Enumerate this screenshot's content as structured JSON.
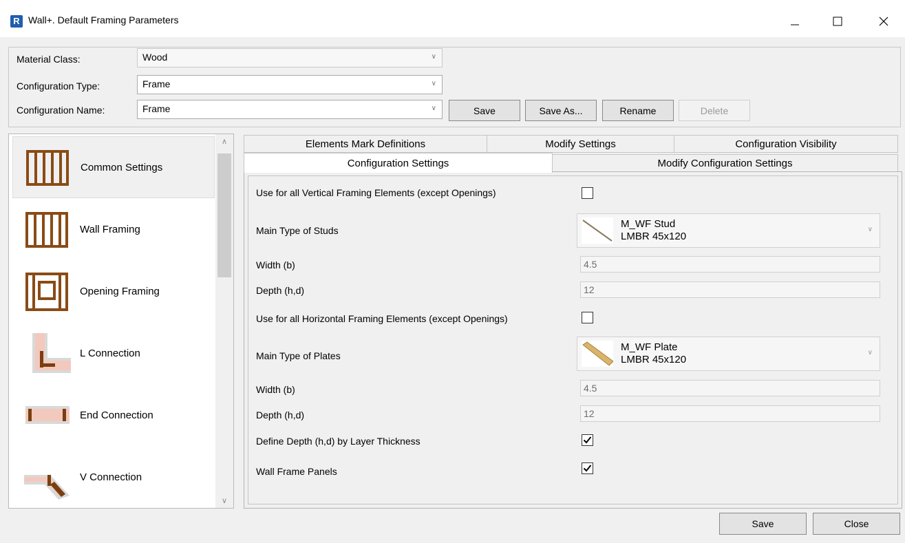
{
  "window": {
    "title": "Wall+. Default Framing Parameters",
    "app_letter": "R"
  },
  "top": {
    "material_class_label": "Material Class:",
    "material_class_value": "Wood",
    "config_type_label": "Configuration Type:",
    "config_type_value": "Frame",
    "config_name_label": "Configuration Name:",
    "config_name_value": "Frame",
    "save_label": "Save",
    "save_as_label": "Save As...",
    "rename_label": "Rename",
    "delete_label": "Delete"
  },
  "sidebar": {
    "items": [
      {
        "label": "Common Settings"
      },
      {
        "label": "Wall Framing"
      },
      {
        "label": "Opening Framing"
      },
      {
        "label": "L Connection"
      },
      {
        "label": "End Connection"
      },
      {
        "label": "V Connection"
      }
    ]
  },
  "tabs": {
    "row1": [
      "Elements Mark Definitions",
      "Modify Settings",
      "Configuration Visibility"
    ],
    "row2": [
      "Configuration Settings",
      "Modify Configuration Settings"
    ]
  },
  "settings": {
    "vertical_label": "Use for all Vertical Framing Elements (except Openings)",
    "vertical_checked": false,
    "studs_label": "Main Type of Studs",
    "studs_family": "M_WF Stud",
    "studs_type": "LMBR 45x120",
    "stud_width_label": "Width (b)",
    "stud_width_value": "4.5",
    "stud_depth_label": "Depth (h,d)",
    "stud_depth_value": "12",
    "horizontal_label": "Use for all Horizontal Framing Elements (except Openings)",
    "horizontal_checked": false,
    "plates_label": "Main Type of Plates",
    "plates_family": "M_WF Plate",
    "plates_type": "LMBR 45x120",
    "plate_width_label": "Width (b)",
    "plate_width_value": "4.5",
    "plate_depth_label": "Depth (h,d)",
    "plate_depth_value": "12",
    "layer_thickness_label": "Define Depth (h,d) by Layer Thickness",
    "layer_thickness_checked": true,
    "panels_label": "Wall Frame Panels",
    "panels_checked": true
  },
  "footer": {
    "save_label": "Save",
    "close_label": "Close"
  }
}
